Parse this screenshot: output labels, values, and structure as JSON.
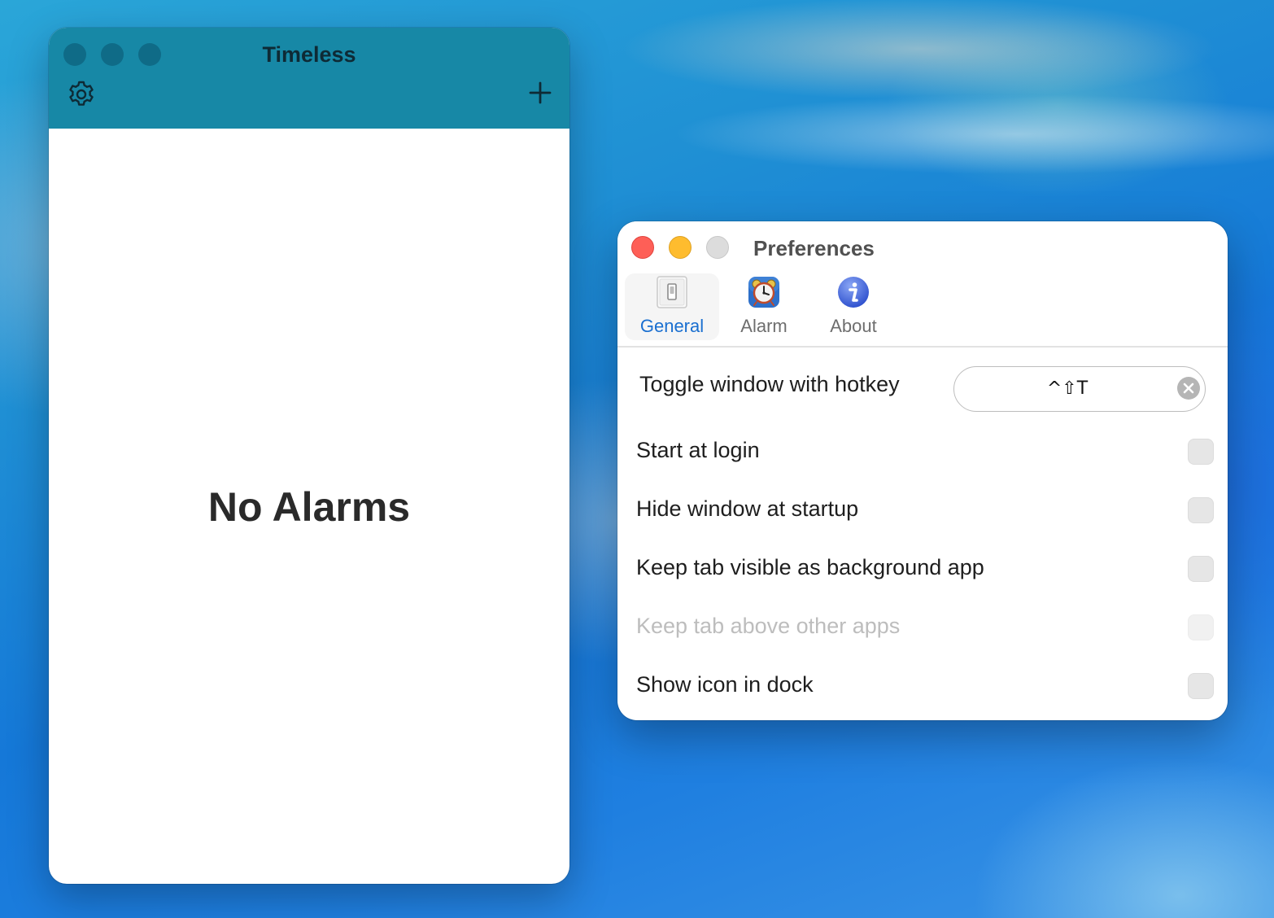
{
  "timeless_window": {
    "title": "Timeless",
    "empty_state": "No Alarms"
  },
  "preferences_window": {
    "title": "Preferences",
    "tabs": [
      {
        "label": "General",
        "icon": "switch-icon",
        "selected": true
      },
      {
        "label": "Alarm",
        "icon": "alarm-clock-icon",
        "selected": false
      },
      {
        "label": "About",
        "icon": "info-icon",
        "selected": false
      }
    ],
    "hotkey": {
      "label": "Toggle window with hotkey",
      "value": "^⇧T"
    },
    "options": [
      {
        "label": "Start at login",
        "checked": false,
        "enabled": true
      },
      {
        "label": "Hide window at startup",
        "checked": false,
        "enabled": true
      },
      {
        "label": "Keep tab visible as background app",
        "checked": false,
        "enabled": true
      },
      {
        "label": "Keep tab above other apps",
        "checked": false,
        "enabled": false
      },
      {
        "label": "Show icon in dock",
        "checked": false,
        "enabled": true
      }
    ]
  },
  "colors": {
    "timeless_header": "#1788a6",
    "accent_blue": "#1a6fd0",
    "close": "#fe5f57",
    "minimize": "#febc2e"
  }
}
